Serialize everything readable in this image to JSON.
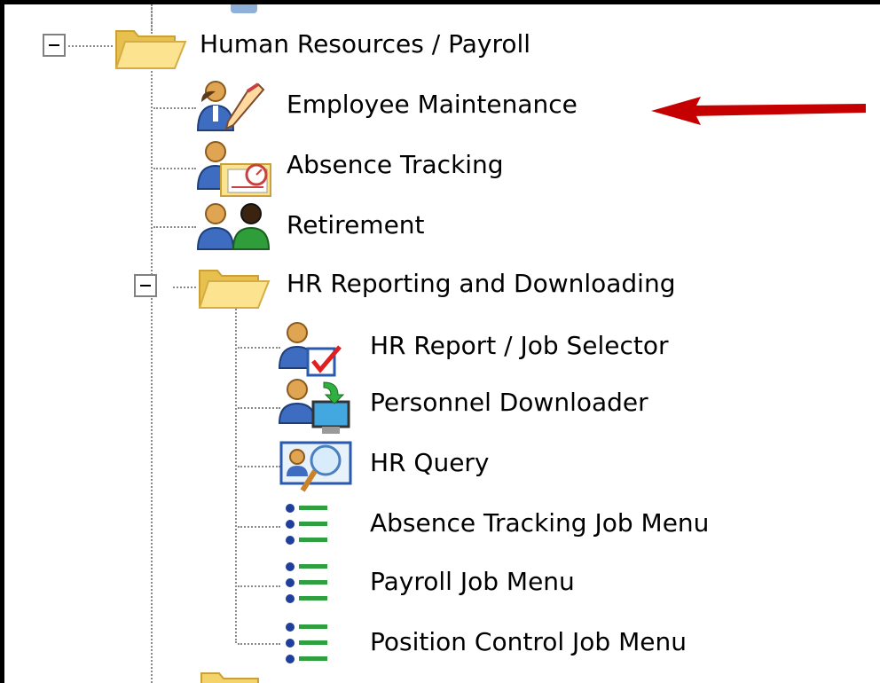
{
  "colors": {
    "tree_lines": "#8a8a8a",
    "folder": "#f4d46a",
    "arrow": "#c40000"
  },
  "tree": {
    "root": {
      "label": "Human Resources / Payroll",
      "icon": "folder-open-icon",
      "expanded": true
    },
    "items": [
      {
        "label": "Employee Maintenance",
        "icon": "employee-edit-icon"
      },
      {
        "label": "Absence Tracking",
        "icon": "absence-tracking-icon"
      },
      {
        "label": "Retirement",
        "icon": "retirement-icon"
      }
    ],
    "subfolder": {
      "label": "HR Reporting and Downloading",
      "icon": "folder-open-icon",
      "expanded": true,
      "items": [
        {
          "label": "HR Report / Job Selector",
          "icon": "report-selector-icon"
        },
        {
          "label": "Personnel Downloader",
          "icon": "downloader-icon"
        },
        {
          "label": "HR Query",
          "icon": "query-magnifier-icon"
        },
        {
          "label": "Absence Tracking Job Menu",
          "icon": "job-menu-list-icon"
        },
        {
          "label": "Payroll Job Menu",
          "icon": "job-menu-list-icon"
        },
        {
          "label": "Position Control Job Menu",
          "icon": "job-menu-list-icon"
        }
      ]
    }
  },
  "annotation": {
    "icon": "red-arrow-icon",
    "points_to": "Employee Maintenance"
  }
}
